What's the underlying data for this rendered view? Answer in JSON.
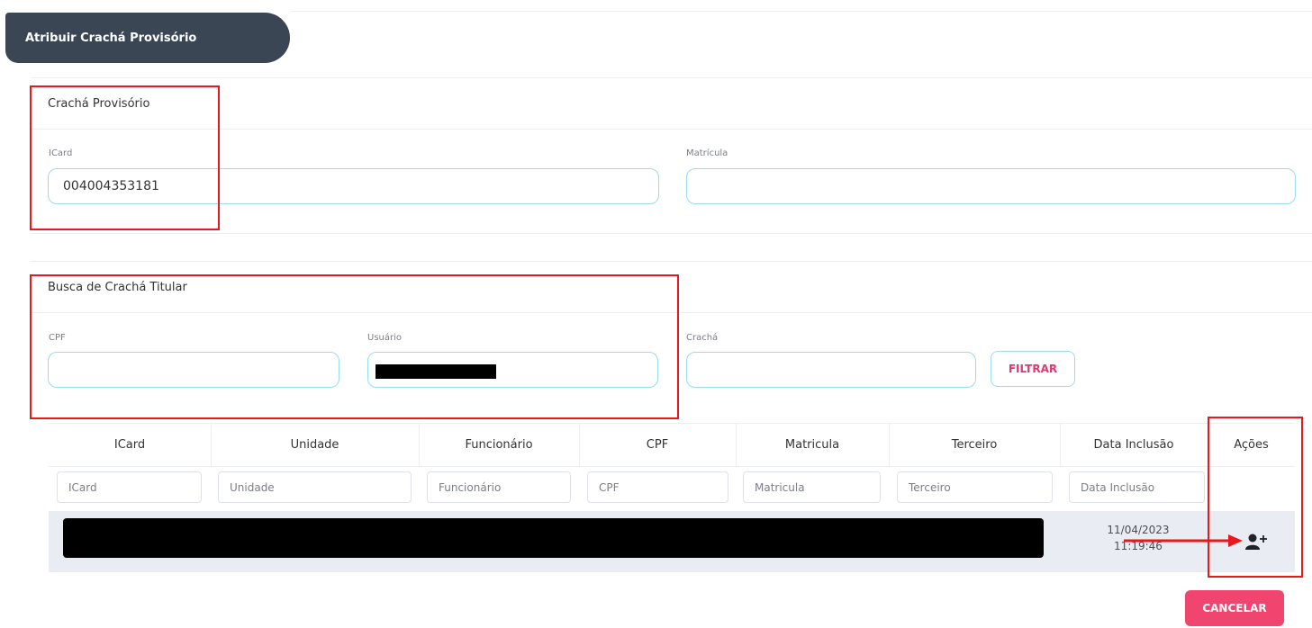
{
  "header": {
    "title": "Atribuir Crachá Provisório"
  },
  "cracha_provisorio": {
    "title": "Crachá Provisório",
    "icard_label": "ICard",
    "icard_value": "004004353181",
    "matricula_label": "Matrícula",
    "matricula_value": ""
  },
  "busca": {
    "title": "Busca de Crachá Titular",
    "cpf_label": "CPF",
    "cpf_value": "",
    "usuario_label": "Usuário",
    "cracha_label": "Crachá",
    "cracha_value": "",
    "filter_button": "FILTRAR"
  },
  "table": {
    "columns": [
      "ICard",
      "Unidade",
      "Funcionário",
      "CPF",
      "Matricula",
      "Terceiro",
      "Data Inclusão",
      "Ações"
    ],
    "filter_placeholders": [
      "ICard",
      "Unidade",
      "Funcionário",
      "CPF",
      "Matricula",
      "Terceiro",
      "Data Inclusão"
    ],
    "rows": [
      {
        "date": "11/04/2023",
        "time": "11:19:46",
        "action_icon": "add-user-icon"
      }
    ]
  },
  "footer": {
    "cancel_button": "CANCELAR"
  },
  "colors": {
    "header_bg": "#3b4654",
    "accent_pink": "#f0456f",
    "field_border": "#9adcf0",
    "highlight_red": "#e8181c"
  }
}
